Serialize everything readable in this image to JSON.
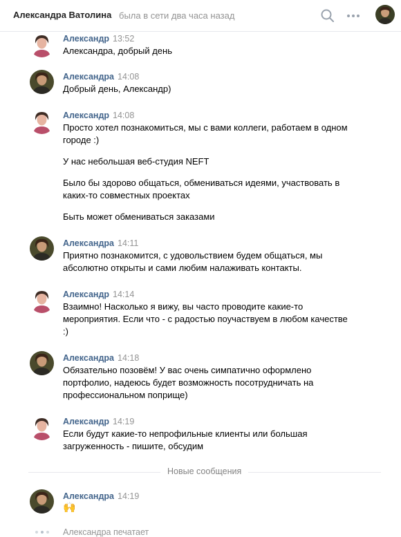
{
  "header": {
    "name": "Александра Ватолина",
    "status": "была в сети два часа назад",
    "search_icon": "search-icon",
    "more_icon": "more-icon"
  },
  "messages": [
    {
      "author": "Александр",
      "time": "13:52",
      "avatar": "alexander",
      "paragraphs": [
        "Александра, добрый день"
      ]
    },
    {
      "author": "Александра",
      "time": "14:08",
      "avatar": "alexandra",
      "paragraphs": [
        "Добрый день, Александр)"
      ]
    },
    {
      "author": "Александр",
      "time": "14:08",
      "avatar": "alexander",
      "paragraphs": [
        "Просто хотел познакомиться, мы с вами коллеги, работаем в одном городе :)",
        "У нас небольшая веб-студия NEFT",
        "Было бы здорово общаться, обмениваться идеями, участвовать в каких-то совместных проектах",
        "Быть может обмениваться заказами"
      ]
    },
    {
      "author": "Александра",
      "time": "14:11",
      "avatar": "alexandra",
      "paragraphs": [
        "Приятно познакомится, с удовольствием будем общаться, мы абсолютно открыты и сами любим налаживать контакты."
      ]
    },
    {
      "author": "Александр",
      "time": "14:14",
      "avatar": "alexander",
      "paragraphs": [
        "Взаимно! Насколько я вижу, вы часто проводите какие-то мероприятия. Если что - с радостью поучаствуем в любом качестве :)"
      ]
    },
    {
      "author": "Александра",
      "time": "14:18",
      "avatar": "alexandra",
      "paragraphs": [
        "Обязательно позовём! У вас очень симпатично оформлено портфолио, надеюсь будет возможность посотрудничать на профессиональном поприще)"
      ]
    },
    {
      "author": "Александр",
      "time": "14:19",
      "avatar": "alexander",
      "paragraphs": [
        "Если будут какие-то непрофильные клиенты или большая загруженность - пишите, обсудим"
      ]
    }
  ],
  "new_messages_label": "Новые сообщения",
  "new_message": {
    "author": "Александра",
    "time": "14:19",
    "avatar": "alexandra",
    "emoji": "🙌"
  },
  "typing": "Александра печатает"
}
